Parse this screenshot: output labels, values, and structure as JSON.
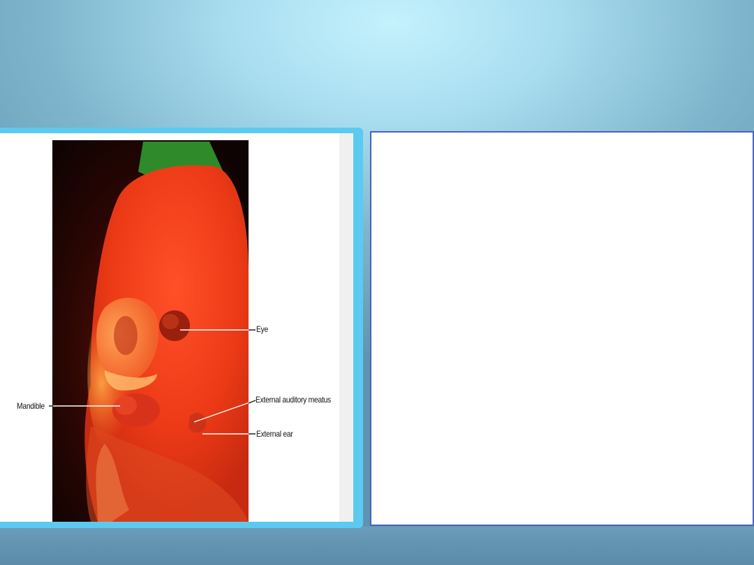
{
  "figure": {
    "labels": {
      "eye": "Eye",
      "mandible": "Mandible",
      "external_auditory_meatus": "External auditory meatus",
      "external_ear": "External ear"
    }
  },
  "colors": {
    "frame": "#5ccaf0",
    "panel_border": "#4a62b8",
    "embryo": "#e8401c"
  }
}
